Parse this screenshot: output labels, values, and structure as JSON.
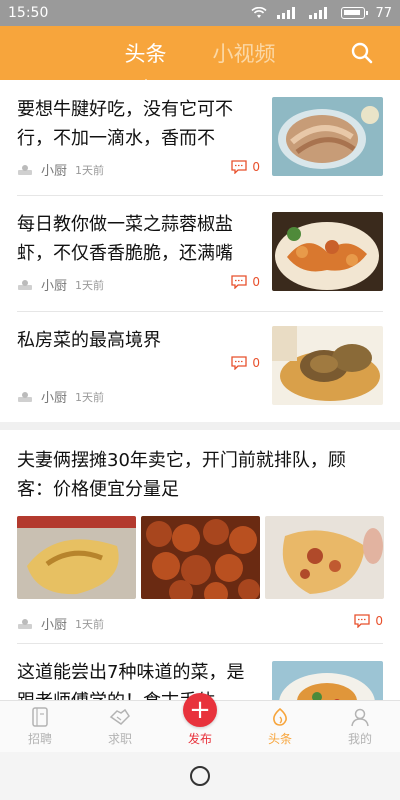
{
  "status_bar": {
    "time": "15:50",
    "battery": "77"
  },
  "header": {
    "tabs": [
      {
        "label": "头条",
        "active": true
      },
      {
        "label": "小视频",
        "active": false
      }
    ]
  },
  "colors": {
    "brand": "#f7a53c",
    "comment": "#e8502c",
    "publish": "#e8323c"
  },
  "articles": [
    {
      "title_line1": "要想牛腱好吃，没有它可不",
      "title_line2": "行，不加一滴水，香而不",
      "source": "小厨",
      "time": "1天前",
      "comments": "0",
      "image": "sliced-beef-tendon-image"
    },
    {
      "title_line1": "每日教你做一菜之蒜蓉椒盐",
      "title_line2": "虾，不仅香香脆脆，还满嘴",
      "source": "小厨",
      "time": "1天前",
      "comments": "0",
      "image": "fried-shrimp-image"
    },
    {
      "title_line1": "私房菜的最高境界",
      "source": "小厨",
      "time": "1天前",
      "comments": "0",
      "image": "braised-abalone-image"
    },
    {
      "title_line1": "夫妻俩摆摊30年卖它，开门前就排队，顾",
      "title_line2": "客：价格便宜分量足",
      "source": "小厨",
      "time": "1天前",
      "comments": "0",
      "images": [
        "pancake-image",
        "sesame-balls-image",
        "fried-pastry-image"
      ]
    },
    {
      "title_line1": "这道能尝出7种味道的菜，是",
      "title_line2": "跟老师傅学的！食古手体",
      "image": "plated-dish-image"
    }
  ],
  "bottom_nav": [
    {
      "label": "招聘",
      "icon": "resume-icon"
    },
    {
      "label": "求职",
      "icon": "handshake-icon"
    },
    {
      "label": "发布",
      "icon": "plus-icon"
    },
    {
      "label": "头条",
      "icon": "headline-icon",
      "active": true
    },
    {
      "label": "我的",
      "icon": "profile-icon"
    }
  ]
}
